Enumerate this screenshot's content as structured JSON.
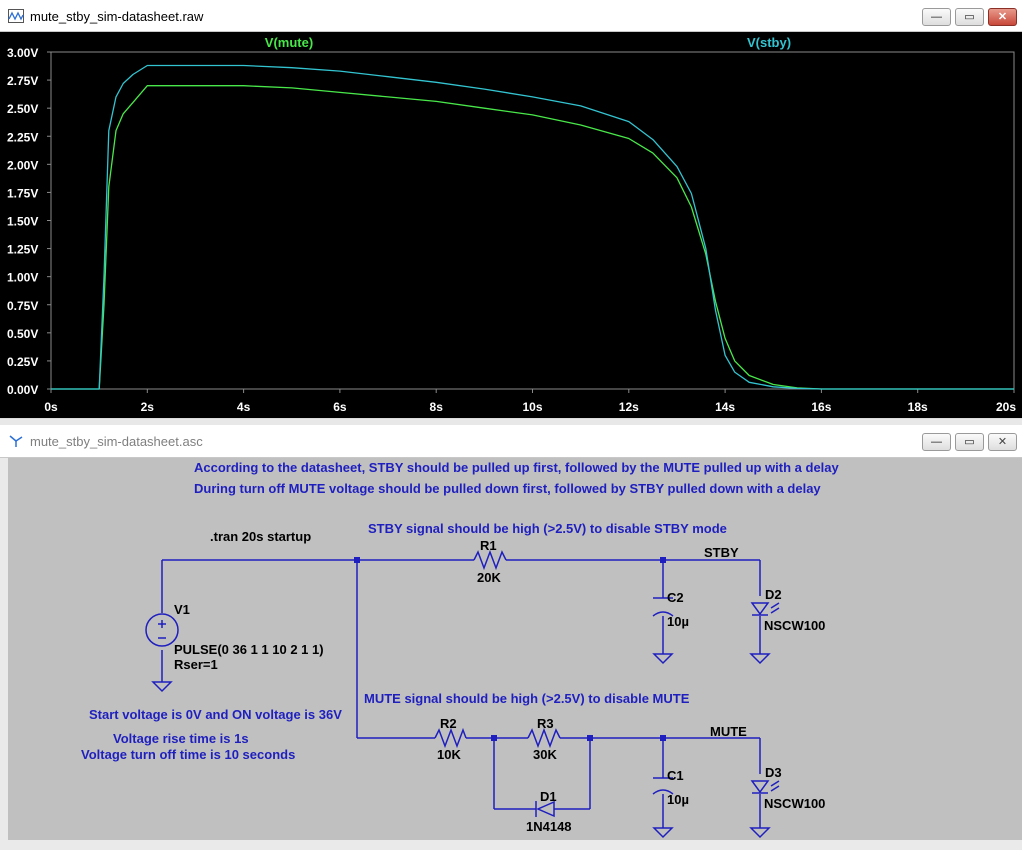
{
  "waveform_window": {
    "title": "mute_stby_sim-datasheet.raw",
    "controls": {
      "minimize": "—",
      "restore": "▭",
      "close": "✕"
    }
  },
  "schematic_window": {
    "title": "mute_stby_sim-datasheet.asc",
    "controls": {
      "minimize": "—",
      "restore": "▭",
      "close": "✕"
    }
  },
  "colors": {
    "mute_trace": "#49e84a",
    "stby_trace": "#33c4d1",
    "plot_bg": "#000000",
    "axis_labels": "#ffffff",
    "schematic_bg": "#c0c0c0",
    "wire": "#1f1fbf",
    "annotation_text": "#1f1fbf",
    "component_text": "#000000"
  },
  "chart_data": {
    "type": "line",
    "x_unit": "s",
    "y_unit": "V",
    "xlim": [
      0,
      20
    ],
    "ylim": [
      0,
      3.0
    ],
    "x_ticks": [
      "0s",
      "2s",
      "4s",
      "6s",
      "8s",
      "10s",
      "12s",
      "14s",
      "16s",
      "18s",
      "20s"
    ],
    "y_ticks": [
      "0.00V",
      "0.25V",
      "0.50V",
      "0.75V",
      "1.00V",
      "1.25V",
      "1.50V",
      "1.75V",
      "2.00V",
      "2.25V",
      "2.50V",
      "2.75V",
      "3.00V"
    ],
    "grid": false,
    "legend": "top",
    "series": [
      {
        "name": "V(mute)",
        "x": [
          0,
          1.0,
          1.1,
          1.2,
          1.35,
          1.5,
          1.7,
          2.0,
          3,
          4,
          5,
          6,
          7,
          8,
          9,
          10,
          11,
          12,
          12.5,
          13,
          13.3,
          13.6,
          13.8,
          14.0,
          14.2,
          14.5,
          15.0,
          15.5,
          16.0,
          17,
          18,
          20
        ],
        "y": [
          0,
          0,
          0.75,
          1.8,
          2.3,
          2.45,
          2.55,
          2.7,
          2.7,
          2.7,
          2.68,
          2.64,
          2.6,
          2.56,
          2.5,
          2.44,
          2.35,
          2.23,
          2.1,
          1.88,
          1.62,
          1.2,
          0.78,
          0.45,
          0.25,
          0.12,
          0.04,
          0.01,
          0.0,
          0.0,
          0.0,
          0.0
        ]
      },
      {
        "name": "V(stby)",
        "x": [
          0,
          1.0,
          1.1,
          1.2,
          1.35,
          1.5,
          1.7,
          2.0,
          3,
          4,
          5,
          6,
          7,
          8,
          9,
          10,
          11,
          12,
          12.5,
          13,
          13.3,
          13.6,
          13.8,
          14.0,
          14.2,
          14.5,
          15.0,
          15.5,
          16.0,
          17,
          18,
          20
        ],
        "y": [
          0,
          0,
          1.0,
          2.3,
          2.6,
          2.72,
          2.8,
          2.88,
          2.88,
          2.88,
          2.86,
          2.83,
          2.78,
          2.73,
          2.67,
          2.6,
          2.52,
          2.38,
          2.22,
          1.98,
          1.74,
          1.25,
          0.7,
          0.3,
          0.15,
          0.06,
          0.02,
          0.005,
          0.0,
          0.0,
          0.0,
          0.0
        ]
      }
    ]
  },
  "schematic": {
    "notes": {
      "line1": "According to the datasheet, STBY should be pulled up first, followed by the MUTE pulled up with a delay",
      "line2": "During turn off MUTE voltage should be pulled down first, followed by STBY pulled down with a delay",
      "stby_note": "STBY signal should be high (>2.5V) to disable STBY mode",
      "mute_note": "MUTE signal should be high (>2.5V) to disable MUTE",
      "tran": ".tran 20s startup",
      "start_voltage": "Start voltage is 0V and ON voltage is 36V",
      "rise_time": "Voltage rise time is 1s",
      "off_time": "Voltage turn off time is 10 seconds"
    },
    "components": {
      "v1": {
        "name": "V1",
        "value": "PULSE(0 36 1 1 10 2 1 1)",
        "rser": "Rser=1"
      },
      "r1": {
        "name": "R1",
        "value": "20K"
      },
      "r2": {
        "name": "R2",
        "value": "10K"
      },
      "r3": {
        "name": "R3",
        "value": "30K"
      },
      "c1": {
        "name": "C1",
        "value": "10µ"
      },
      "c2": {
        "name": "C2",
        "value": "10µ"
      },
      "d1": {
        "name": "D1",
        "value": "1N4148"
      },
      "d2": {
        "name": "D2",
        "value": "NSCW100"
      },
      "d3": {
        "name": "D3",
        "value": "NSCW100"
      }
    },
    "net_labels": {
      "stby": "STBY",
      "mute": "MUTE"
    }
  }
}
